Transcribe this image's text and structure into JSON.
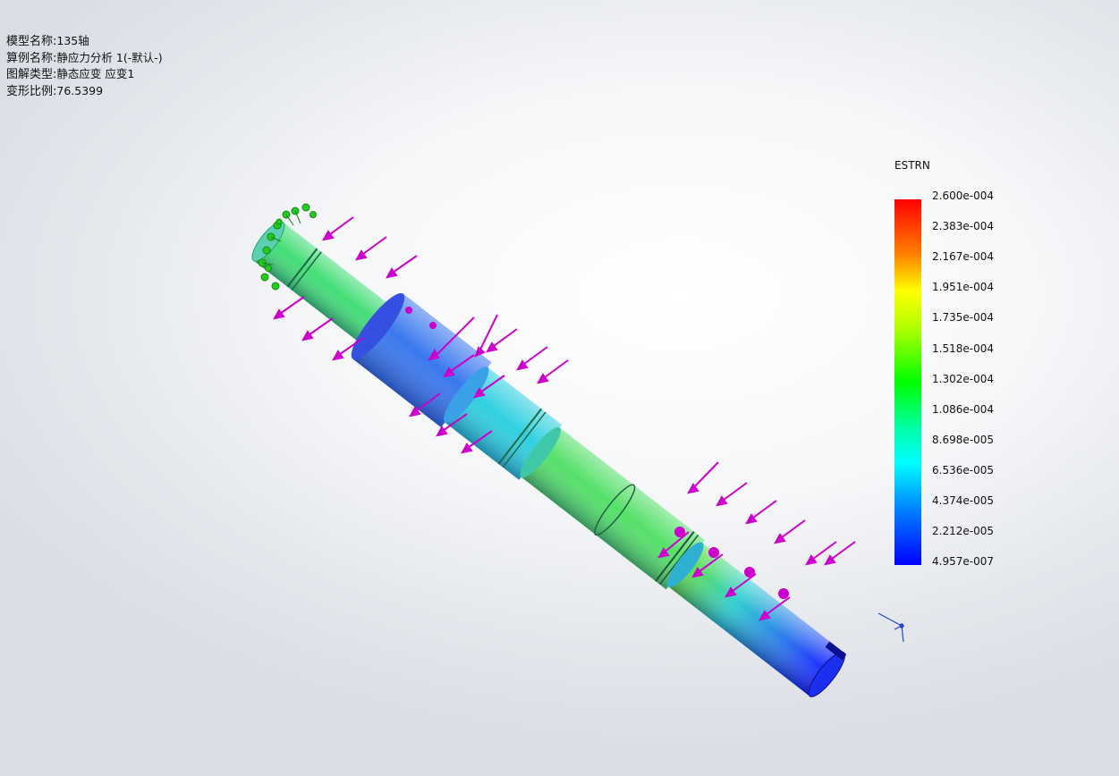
{
  "model_info": {
    "model_name_label": "模型名称:",
    "model_name_value": "135轴",
    "study_name_label": "算例名称:",
    "study_name_value": "静应力分析 1(-默认-)",
    "plot_type_label": "图解类型:",
    "plot_type_value": "静态应变 应变1",
    "deformation_scale_label": "变形比例:",
    "deformation_scale_value": "76.5399"
  },
  "legend": {
    "title": "ESTRN",
    "ticks": [
      "2.600e-004",
      "2.383e-004",
      "2.167e-004",
      "1.951e-004",
      "1.735e-004",
      "1.518e-004",
      "1.302e-004",
      "1.086e-004",
      "8.698e-005",
      "6.536e-005",
      "4.374e-005",
      "2.212e-005",
      "4.957e-007"
    ],
    "max_color": "#ff0000",
    "min_color": "#0000ff"
  },
  "colors": {
    "load_arrow": "#cc00cc",
    "fixture_marker": "#22cc22",
    "triad": "#2244cc"
  }
}
